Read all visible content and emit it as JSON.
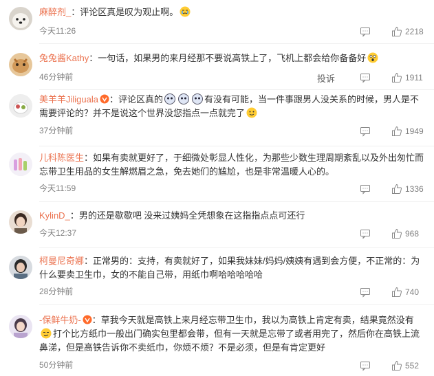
{
  "comments": [
    {
      "author": "麻醉剂_",
      "colon": "：",
      "text": "评论区真是叹为观止啊。",
      "time": "今天11:26",
      "likes": "2218",
      "author_dark": false
    },
    {
      "author": "兔兔酱Kathy",
      "colon": "：",
      "text": "一句话，如果男的来月经那不要说高铁上了，飞机上都会给你备备好",
      "time": "46分钟前",
      "likes": "1911",
      "report": "投诉",
      "author_dark": false
    },
    {
      "author": "美羊羊Jiliguala",
      "colon": "：",
      "text1": "评论区真的",
      "text2": "有没有可能，当一件事跟男人没关系的时候，男人是不需要评论的？并不是说这个世界没您指点一点就完了",
      "time": "37分钟前",
      "likes": "1949",
      "author_dark": false
    },
    {
      "author": "儿科陈医生",
      "colon": "：",
      "text": "如果有卖就更好了，于细微处彰显人性化，为那些少数生理周期紊乱以及外出匆忙而忘带卫生用品的女生解燃眉之急，免去她们的尴尬，也是非常温暖人心的。",
      "time": "今天11:59",
      "likes": "1336",
      "author_dark": false
    },
    {
      "author": "KylinD_",
      "colon": "：",
      "text": "男的还是歇歇吧 没来过姨妈全凭想象在这指指点点可还行",
      "time": "今天12:37",
      "likes": "968",
      "author_dark": false
    },
    {
      "author": "柯曼尼奇娜",
      "colon": "：",
      "text": "正常男的：支持，有卖就好了，如果我妹妹/妈妈/姨姨有遇到会方便，不正常的：为什么要卖卫生巾，女的不能自己带，用纸巾啊哈哈哈哈哈",
      "time": "28分钟前",
      "likes": "740",
      "author_dark": false
    },
    {
      "author": "-保鲜牛奶-",
      "colon": "：",
      "text1": "草我今天就是高铁上来月经忘带卫生巾，我以为高铁上肯定有卖，结果竟然没有",
      "text2": "打个比方纸巾一般出门确实包里都会带，但有一天就是忘带了或者用完了，然后你在高铁上流鼻涕，但是高铁告诉你不卖纸巾，你烦不烦？不是必须，但是有肯定更好",
      "time": "50分钟前",
      "likes": "552",
      "author_dark": false
    }
  ],
  "icons": {
    "reply": "comment-icon",
    "like": "thumb-up-icon"
  },
  "colors": {
    "author": "#eb7350",
    "meta": "#808080",
    "text": "#333333"
  }
}
